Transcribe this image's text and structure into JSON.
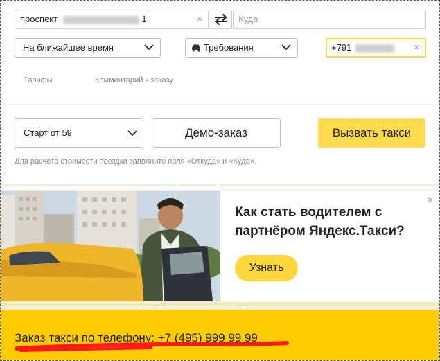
{
  "route": {
    "from_value_prefix": "проспект",
    "from_value_suffix": "1",
    "to_placeholder": "Куда",
    "clear_symbol": "×"
  },
  "options": {
    "time_label": "На ближайшее время",
    "requirements_label": "Требования",
    "phone_value_prefix": "+791"
  },
  "tabs": {
    "tariffs": "Тарифы",
    "comment": "Комментарий к заказу"
  },
  "order": {
    "start_price": "Старт от 59",
    "demo_button": "Демо-заказ",
    "call_button": "Вызвать такси",
    "hint": "Для расчёта стоимости поездки заполните поля «Откуда» и «Куда»."
  },
  "ad": {
    "title": "Как стать водителем с партнёром Яндекс.Такси?",
    "button": "Узнать",
    "close_symbol": "×"
  },
  "footer": {
    "phone_order_text": "Заказ такси по телефону: +7 (495) 999 99 99"
  },
  "colors": {
    "accent_yellow": "#ffdb4d",
    "footer_yellow": "#ffcc00",
    "underline_red": "#ff1a1a",
    "phone_field_border": "#ffd94a"
  }
}
